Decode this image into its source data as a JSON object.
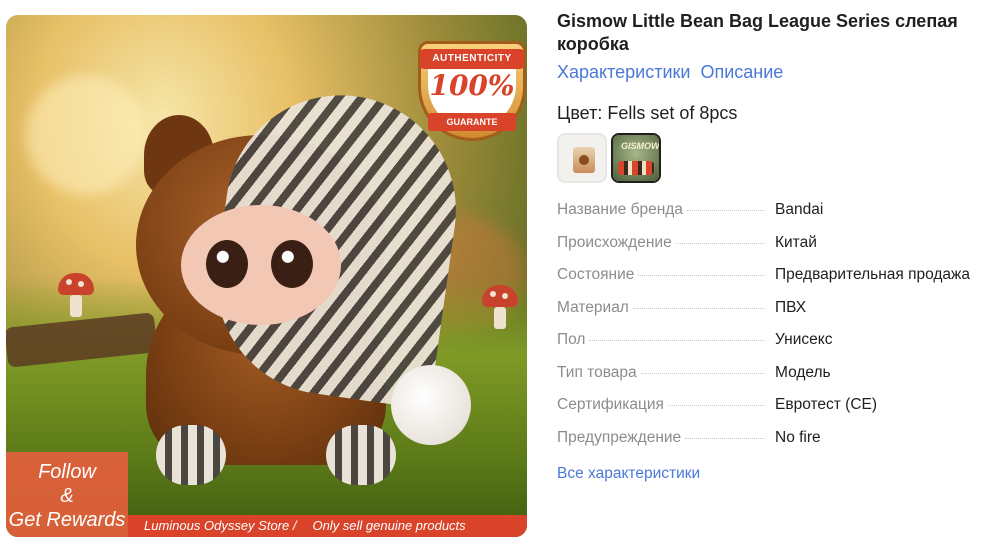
{
  "image": {
    "alt_subject": "plush-toy",
    "badge": {
      "top_text": "AUTHENTICITY",
      "percent": "100%",
      "bottom_text": "GUARANTE"
    },
    "follow": {
      "line1": "Follow",
      "line2": "&",
      "line3": "Get Rewards"
    },
    "store_bar": {
      "store": "Luminous Odyssey Store /",
      "tagline": "Only sell genuine products"
    },
    "colors": {
      "accent_red": "#d8432a",
      "follow_bg": "#e2603c"
    }
  },
  "product": {
    "title": "Gismow Little Bean Bag League Series слепая коробка",
    "tabs": [
      {
        "label": "Характеристики"
      },
      {
        "label": "Описание"
      }
    ],
    "color_label": "Цвет: Fells set of 8pcs",
    "swatches": [
      {
        "name": "single-box",
        "selected": false
      },
      {
        "name": "set-of-8",
        "selected": true,
        "label": "GISMOW"
      }
    ],
    "specs": [
      {
        "key": "Название бренда",
        "value": "Bandai"
      },
      {
        "key": "Происхождение",
        "value": "Китай"
      },
      {
        "key": "Состояние",
        "value": "Предварительная продажа"
      },
      {
        "key": "Материал",
        "value": "ПВХ"
      },
      {
        "key": "Пол",
        "value": "Унисекс"
      },
      {
        "key": "Тип товара",
        "value": "Модель"
      },
      {
        "key": "Сертификация",
        "value": "Евротест (CE)"
      },
      {
        "key": "Предупреждение",
        "value": "No fire"
      }
    ],
    "all_specs_link": "Все характеристики",
    "link_color": "#4a78d9"
  }
}
